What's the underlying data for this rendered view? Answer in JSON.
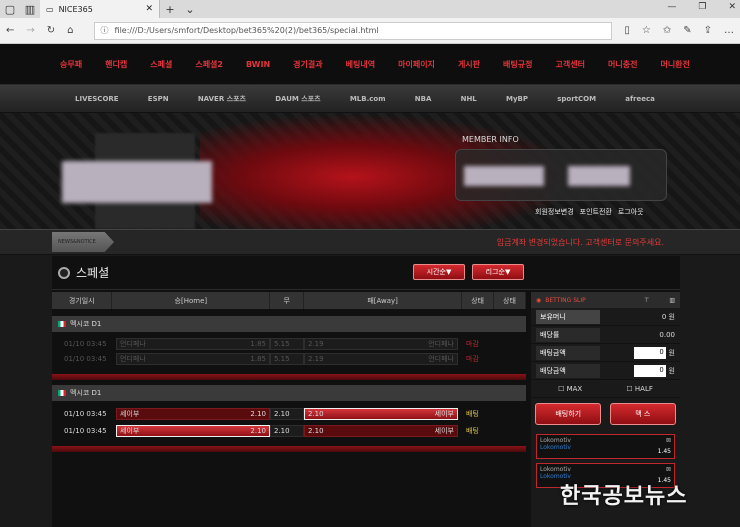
{
  "browser": {
    "tab_title": "NICE365",
    "url": "file:///D:/Users/smfort/Desktop/bet365%20(2)/bet365/special.html"
  },
  "nav": [
    "승무패",
    "핸디캡",
    "스페셜",
    "스페셜2",
    "BWIN",
    "경기결과",
    "베팅내역",
    "마이페이지",
    "게시판",
    "배팅규정",
    "고객센터",
    "머니충전",
    "머니환전"
  ],
  "sponsors": [
    "LIVESCORE",
    "ESPN",
    "NAVER 스포츠",
    "DAUM 스포츠",
    "MLB.com",
    "NBA",
    "NHL",
    "MyBP",
    "sportCOM",
    "afreeca"
  ],
  "member": {
    "title": "MEMBER INFO",
    "links": [
      "회원정보변경",
      "포인트전환",
      "로그아웃"
    ]
  },
  "notice": {
    "tag": "NEWS&NOTICE",
    "text": "입금계좌 변경되었습니다. 고객센터로 문의주세요."
  },
  "section": {
    "title": "스페셜",
    "sort_time": "시간순▼",
    "sort_league": "리그순▼"
  },
  "headers": [
    "경기일시",
    "승[Home]",
    "무",
    "패[Away]",
    "상태",
    "상태"
  ],
  "groups": [
    {
      "league": "멕시코 D1",
      "rows": [
        {
          "time": "01/10 03:45",
          "home": "언디페나",
          "h": "1.85",
          "d": "5.15",
          "a": "2.19",
          "away": "언디페나",
          "status": "마감"
        },
        {
          "time": "01/10 03:45",
          "home": "언디페나",
          "h": "1.85",
          "d": "5.15",
          "a": "2.19",
          "away": "언디페나",
          "status": "마감"
        }
      ]
    },
    {
      "league": "멕시코 D1",
      "rows": [
        {
          "time": "01/10 03:45",
          "home": "세이부",
          "h": "2.10",
          "d": "2.10",
          "a": "2.10",
          "away": "세이부",
          "status": "배팅"
        },
        {
          "time": "01/10 03:45",
          "home": "세이부",
          "h": "2.10",
          "d": "2.10",
          "a": "2.10",
          "away": "세이부",
          "status": "배팅"
        }
      ]
    }
  ],
  "slip": {
    "title": "BETTING SLIP",
    "balance_label": "보유머니",
    "balance": "0 원",
    "rate_label": "배당률",
    "rate": "0.00",
    "bet_label": "배팅금액",
    "bet_value": "0",
    "unit": "원",
    "win_label": "배당금액",
    "win_value": "0",
    "max": "MAX",
    "half": "HALF",
    "bet_button": "배팅하기",
    "cancel_button": "맥 스",
    "picks": [
      {
        "team": "Lokomotiv",
        "sub": "Lokomotiv",
        "odds": "1.45"
      },
      {
        "team": "Lokomotiv",
        "sub": "Lokomotiv",
        "odds": "1.45"
      }
    ]
  },
  "watermark": "한국공보뉴스"
}
